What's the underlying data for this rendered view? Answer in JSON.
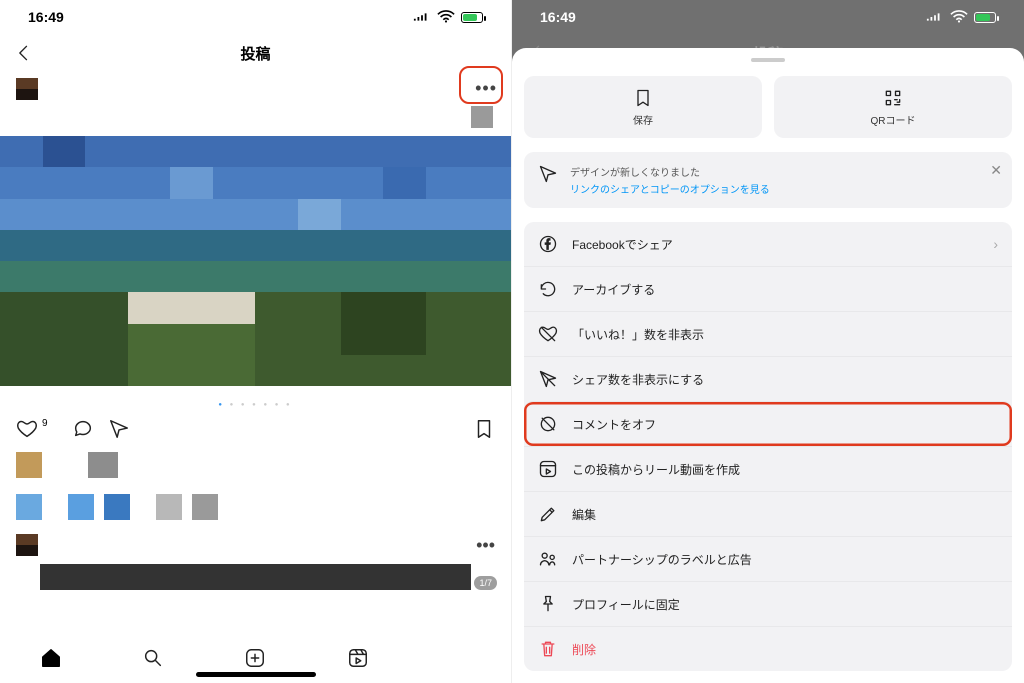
{
  "status": {
    "time": "16:49"
  },
  "left": {
    "title": "投稿",
    "like_count": "9",
    "page_count": "1/7"
  },
  "right": {
    "title": "投稿",
    "save": "保存",
    "qr": "QRコード",
    "notice_line1": "デザインが新しくなりました",
    "notice_line2": "リンクのシェアとコピーのオプションを見る",
    "menu": {
      "facebook": "Facebookでシェア",
      "archive": "アーカイブする",
      "hide_likes": "「いいね！」数を非表示",
      "hide_shares": "シェア数を非表示にする",
      "comments_off": "コメントをオフ",
      "create_reel": "この投稿からリール動画を作成",
      "edit": "編集",
      "partnership": "パートナーシップのラベルと広告",
      "pin": "プロフィールに固定",
      "delete": "削除"
    }
  }
}
